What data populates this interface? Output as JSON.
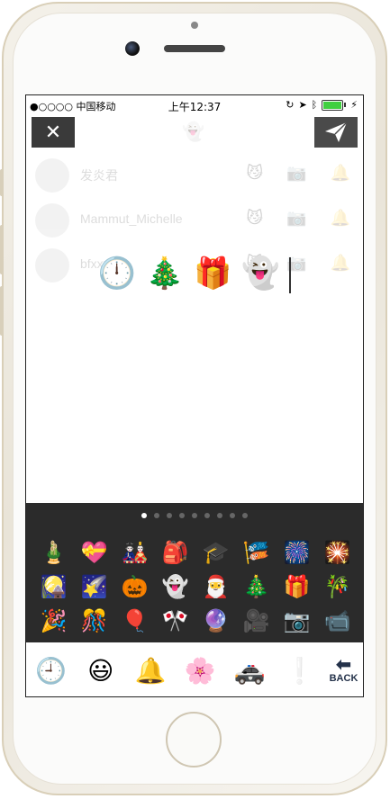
{
  "status": {
    "carrier": "●○○○○ 中国移动",
    "time": "上午12:37"
  },
  "header": {
    "close_icon": "close-icon",
    "send_icon": "paper-plane-icon",
    "center_icon": "ghost"
  },
  "contacts": [
    {
      "name": "发炎君"
    },
    {
      "name": "Mammut_Michelle"
    },
    {
      "name": "bfxxxx"
    }
  ],
  "compose": {
    "emojis": [
      "🕛",
      "🎄",
      "🎁",
      "👻"
    ]
  },
  "keyboard": {
    "pages": 9,
    "active_page": 0,
    "emojis": [
      "🎍",
      "💝",
      "🎎",
      "🎒",
      "🎓",
      "🎏",
      "🎆",
      "🎇",
      "🎑",
      "🌠",
      "🎃",
      "👻",
      "🎅",
      "🎄",
      "🎁",
      "🎋",
      "🎉",
      "🎊",
      "🎈",
      "🎌",
      "🔮",
      "🎥",
      "📷",
      "📹"
    ]
  },
  "tabs": {
    "items": [
      "🕘",
      "😃",
      "🔔",
      "🌸",
      "🚓",
      "❕"
    ],
    "back_label": "BACK"
  }
}
